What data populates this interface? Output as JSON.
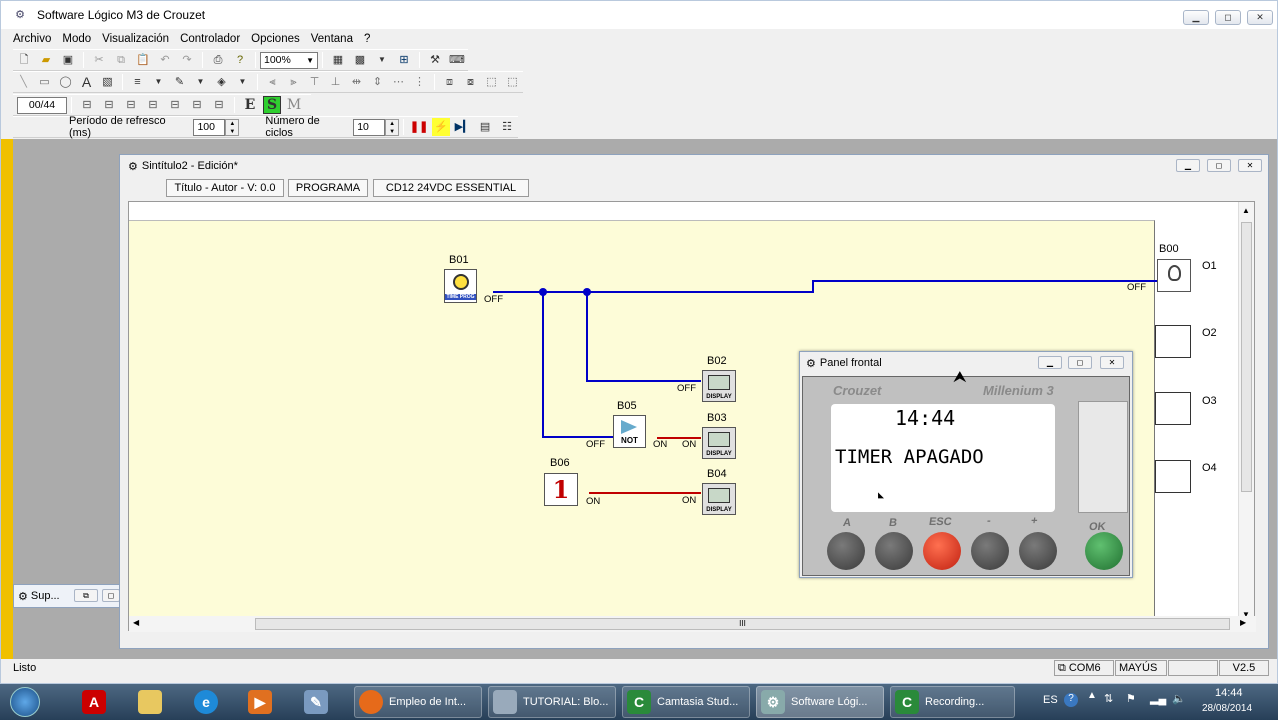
{
  "window": {
    "title": "Software Lógico M3 de Crouzet"
  },
  "menu": [
    "Archivo",
    "Modo",
    "Visualización",
    "Controlador",
    "Opciones",
    "Ventana",
    "?"
  ],
  "toolbar": {
    "zoom": "100%",
    "counter": "00/44"
  },
  "mode_buttons": [
    "E",
    "S",
    "M"
  ],
  "refresh": {
    "label": "Período de refresco (ms)",
    "value": "100"
  },
  "cycles": {
    "label": "Número de ciclos",
    "value": "10"
  },
  "child": {
    "title": "Sintítulo2 - Edición*",
    "info": [
      "Título - Autor - V: 0.0",
      "PROGRAMA",
      "CD12  24VDC ESSENTIAL"
    ]
  },
  "blocks": {
    "b01": {
      "id": "B01",
      "label": "TIME PROG",
      "pin": "OFF"
    },
    "b00": {
      "id": "B00",
      "pin": "OFF"
    },
    "b02": {
      "id": "B02",
      "label": "DISPLAY",
      "pin": "OFF"
    },
    "b05": {
      "id": "B05",
      "label": "NOT",
      "pin_in": "OFF",
      "pin_out": "ON"
    },
    "b03": {
      "id": "B03",
      "label": "DISPLAY",
      "pin": "ON"
    },
    "b06": {
      "id": "B06",
      "value": "1",
      "pin": "ON"
    },
    "b04": {
      "id": "B04",
      "label": "DISPLAY",
      "pin": "ON"
    }
  },
  "outputs": [
    "O1",
    "O2",
    "O3",
    "O4"
  ],
  "hscroll_mark": "III",
  "side_window": {
    "title": "Sup..."
  },
  "panel": {
    "title": "Panel frontal",
    "brand": "Crouzet",
    "model": "Millenium 3",
    "lcd_time": "14:44",
    "lcd_text": "TIMER APAGADO",
    "keys": [
      "A",
      "B",
      "ESC",
      "-",
      "+",
      "OK"
    ]
  },
  "status": {
    "text": "Listo",
    "port": "COM6",
    "caps": "MAYÚS",
    "version": "V2.5"
  },
  "taskbar": {
    "items": [
      "Empleo de Int...",
      "TUTORIAL: Blo...",
      "Camtasia Stud...",
      "Software Lógi...",
      "Recording..."
    ],
    "lang": "ES",
    "time": "14:44",
    "date": "28/08/2014"
  },
  "colors": {
    "wire_blue": "#0000c8",
    "wire_red": "#c00000",
    "lcd_bg": "#ffffff",
    "taskbar": "#2f4a66",
    "canvas": "#fdfcd8"
  }
}
